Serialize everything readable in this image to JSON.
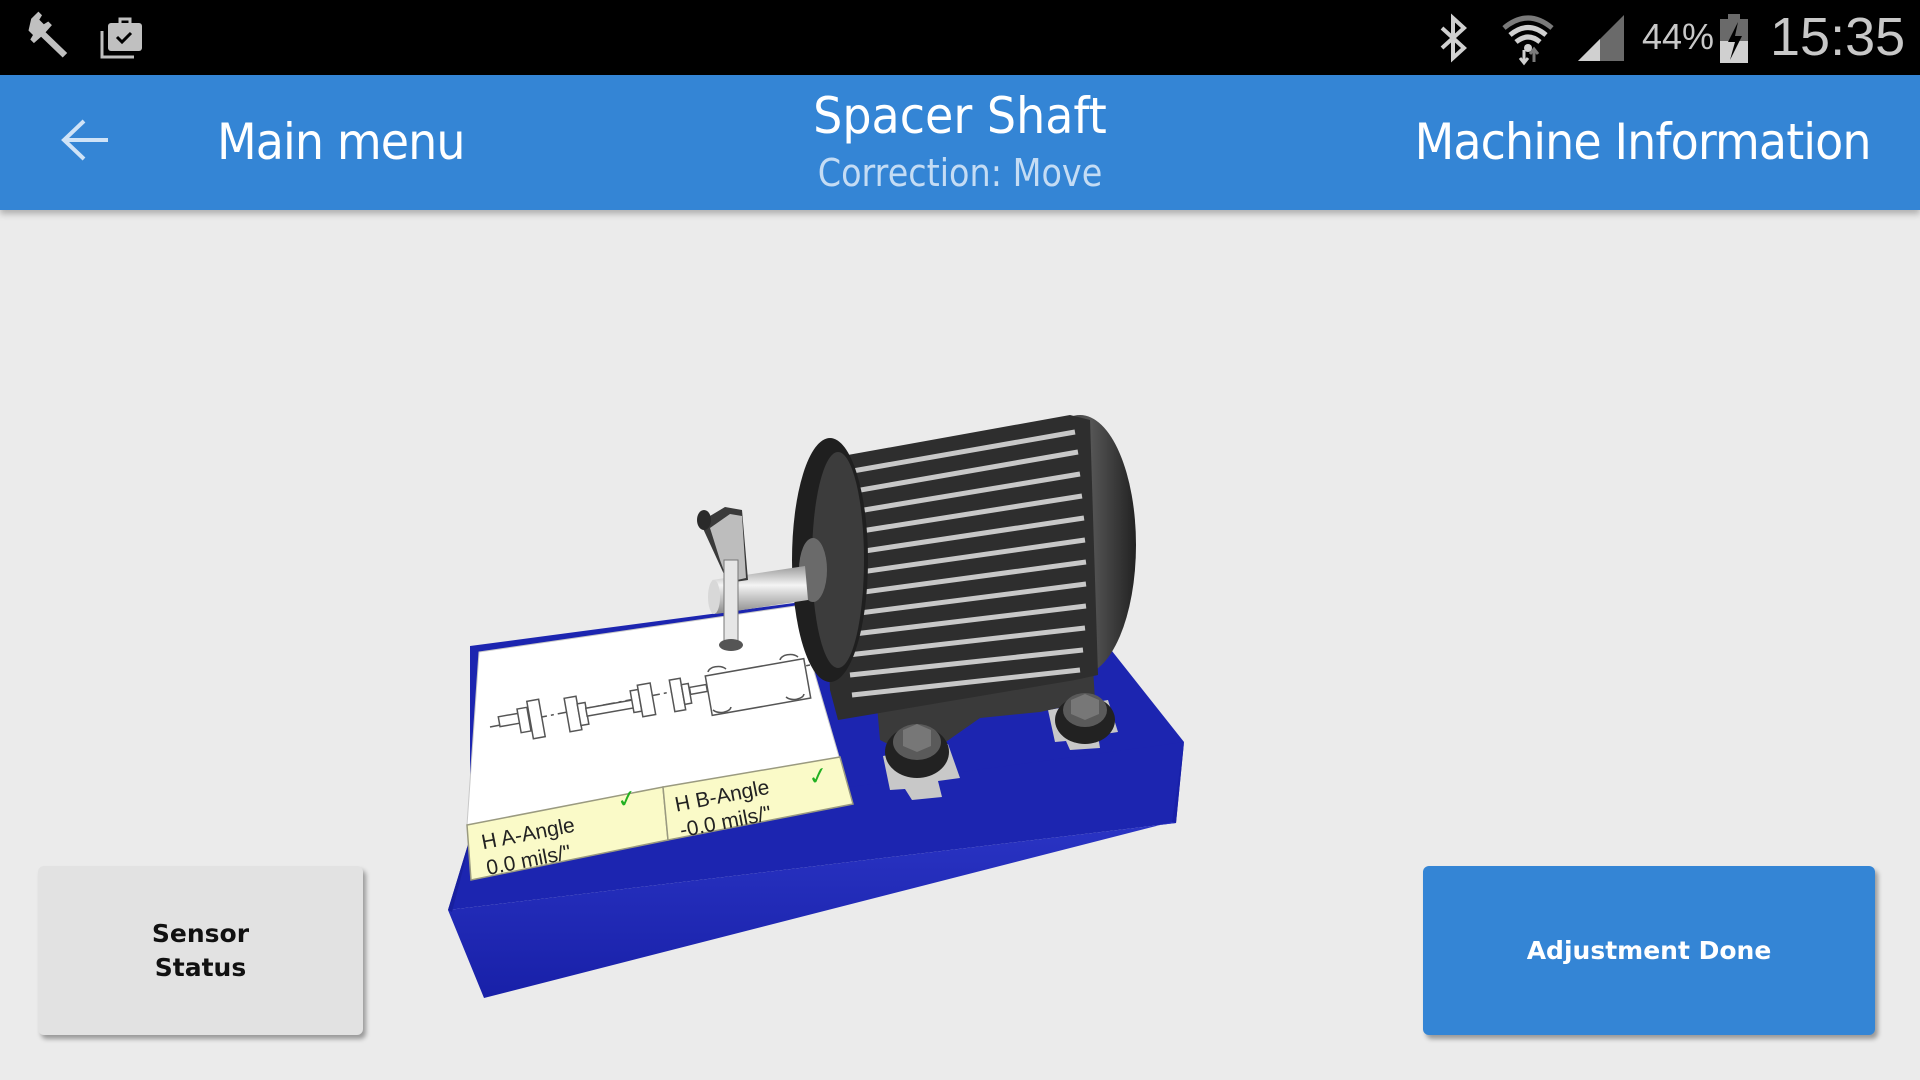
{
  "status_bar": {
    "left_icons": [
      "wrench-icon",
      "briefcase-check-icon"
    ],
    "right_icons": [
      "bluetooth-icon",
      "wifi-icon",
      "signal-icon",
      "battery-charging-icon"
    ],
    "battery_percent": "44%",
    "time": "15:35"
  },
  "app_bar": {
    "back_icon": "arrow-left-icon",
    "back_label": "Main menu",
    "title": "Spacer Shaft",
    "subtitle": "Correction: Move",
    "right_action": "Machine Information"
  },
  "scene": {
    "description": "3D machine model: motor on blue base with sensor on shaft",
    "panel": {
      "readings": [
        {
          "label": "H A-Angle",
          "value": "0.0 mils/\"",
          "status": "ok"
        },
        {
          "label": "H B-Angle",
          "value": "-0.0 mils/\"",
          "status": "ok"
        }
      ],
      "check_symbol": "✓"
    },
    "colors": {
      "base": "#1e28b4",
      "panel_reading_bg": "#fafac8",
      "check": "#22b022"
    }
  },
  "buttons": {
    "sensor_status_line1": "Sensor",
    "sensor_status_line2": "Status",
    "adjustment_done": "Adjustment Done"
  },
  "colors": {
    "accent": "#3485d5",
    "background": "#ebebeb",
    "status_bar": "#000000"
  }
}
